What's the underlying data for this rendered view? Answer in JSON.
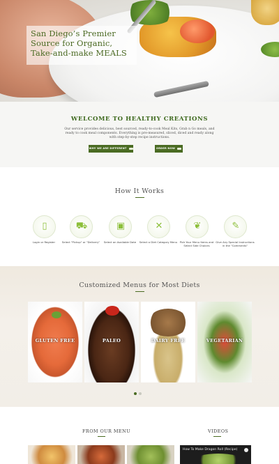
{
  "hero": {
    "title": "San Diego’s Premier Source for Organic, Take-and-make MEALS"
  },
  "welcome": {
    "heading": "WELCOME TO HEALTHY CREATIONS",
    "description": "Our service provides delicious, best sourced, ready-to-cook Meal Kits, Grab n Go meals, and ready to cook meal components. Everything is pre-measured, sliced, diced and ready along with step-by-step recipe instructions.",
    "btn_different": "WHY WE ARE DIFFERENT",
    "btn_order": "ORDER NOW"
  },
  "how": {
    "heading": "How It Works",
    "steps": [
      {
        "label": "Login or Register",
        "icon": "phone-icon"
      },
      {
        "label": "Select \"Pickup\" or \"Delivery\"",
        "icon": "truck-icon"
      },
      {
        "label": "Select an Available Date",
        "icon": "calendar-icon"
      },
      {
        "label": "Select a Diet Category Menu",
        "icon": "utensils-icon"
      },
      {
        "label": "Pick Your Menu Items and Select Side Choices",
        "icon": "vegetables-icon"
      },
      {
        "label": "Give Any Special Instructions in the \"Comments\"",
        "icon": "notepad-icon"
      }
    ]
  },
  "menus": {
    "heading": "Customized Menus for Most Diets",
    "cards": [
      {
        "caption": "GLUTEN FREE"
      },
      {
        "caption": "PALEO"
      },
      {
        "caption": "DAIRY FREE"
      },
      {
        "caption": "VEGETARIAN"
      }
    ]
  },
  "bottom": {
    "from_menu": "FROM OUR MENU",
    "videos": "VIDEOS",
    "video_title": "How To Make Dragon Roll (Recipe)"
  },
  "colors": {
    "accent_green": "#4a6b22",
    "icon_green": "#8cbf3a"
  }
}
